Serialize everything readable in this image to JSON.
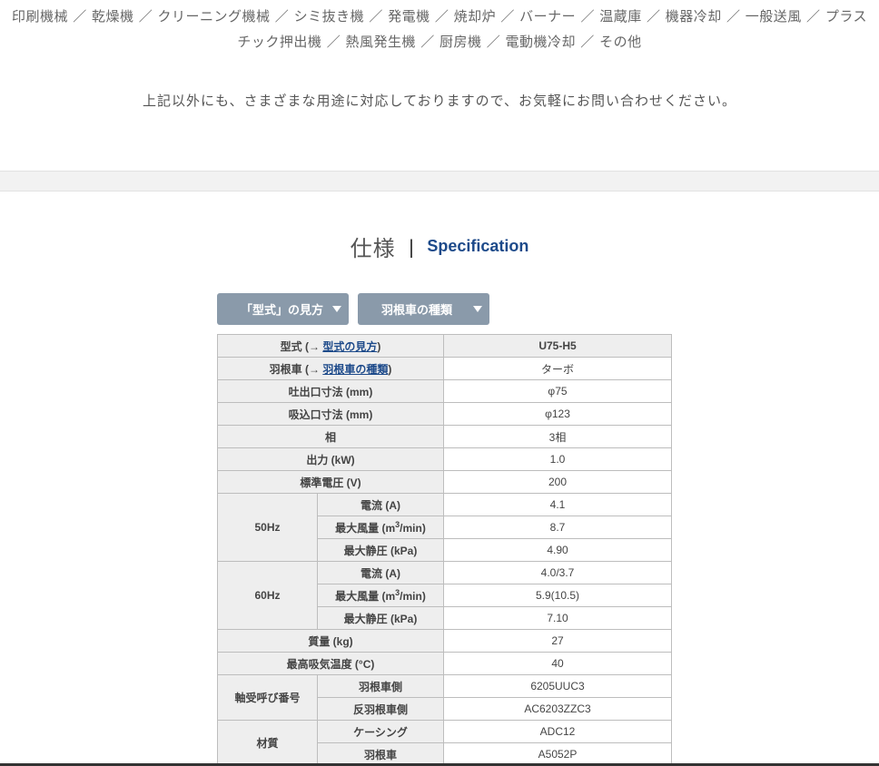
{
  "applications": {
    "line1": "印刷機械 ／ 乾燥機 ／ クリーニング機械 ／ シミ抜き機 ／ 発電機 ／ 焼却炉 ／ バーナー ／ 温蔵庫 ／ 機器冷却 ／ 一般送風 ／ プラス",
    "line2": "チック押出機 ／ 熱風発生機 ／ 厨房機 ／ 電動機冷却 ／ その他"
  },
  "note": "上記以外にも、さまざまな用途に対応しておりますので、お気軽にお問い合わせください。",
  "heading": {
    "ja": "仕様",
    "separator": "|",
    "en": "Specification"
  },
  "buttons": {
    "model_guide": "「型式」の見方",
    "impeller_types": "羽根車の種類"
  },
  "spec": {
    "model_label_prefix": "型式 (→ ",
    "model_link": "型式の見方",
    "model_label_suffix": ")",
    "model_value": "U75-H5",
    "impeller_label_prefix": "羽根車 (→ ",
    "impeller_link": "羽根車の種類",
    "impeller_label_suffix": ")",
    "impeller_value": "ターボ",
    "outlet_label": "吐出口寸法 (mm)",
    "outlet_value": "φ75",
    "inlet_label": "吸込口寸法 (mm)",
    "inlet_value": "φ123",
    "phase_label": "相",
    "phase_value": "3相",
    "output_label": "出力 (kW)",
    "output_value": "1.0",
    "voltage_label": "標準電圧 (V)",
    "voltage_value": "200",
    "hz50": {
      "label": "50Hz",
      "current_label": "電流 (A)",
      "current_value": "4.1",
      "airflow_label_pre": "最大風量 (m",
      "airflow_sup": "3",
      "airflow_label_post": "/min)",
      "airflow_value": "8.7",
      "pressure_label": "最大静圧 (kPa)",
      "pressure_value": "4.90"
    },
    "hz60": {
      "label": "60Hz",
      "current_label": "電流 (A)",
      "current_value": "4.0/3.7",
      "airflow_label_pre": "最大風量 (m",
      "airflow_sup": "3",
      "airflow_label_post": "/min)",
      "airflow_value": "5.9(10.5)",
      "pressure_label": "最大静圧 (kPa)",
      "pressure_value": "7.10"
    },
    "mass_label": "質量 (kg)",
    "mass_value": "27",
    "temp_label": "最高吸気温度 (°C)",
    "temp_value": "40",
    "bearing": {
      "label": "軸受呼び番号",
      "impeller_side_label": "羽根車側",
      "impeller_side_value": "6205UUC3",
      "opposite_side_label": "反羽根車側",
      "opposite_side_value": "AC6203ZZC3"
    },
    "material": {
      "label": "材質",
      "casing_label": "ケーシング",
      "casing_value": "ADC12",
      "impeller_label": "羽根車",
      "impeller_value": "A5052P"
    }
  }
}
